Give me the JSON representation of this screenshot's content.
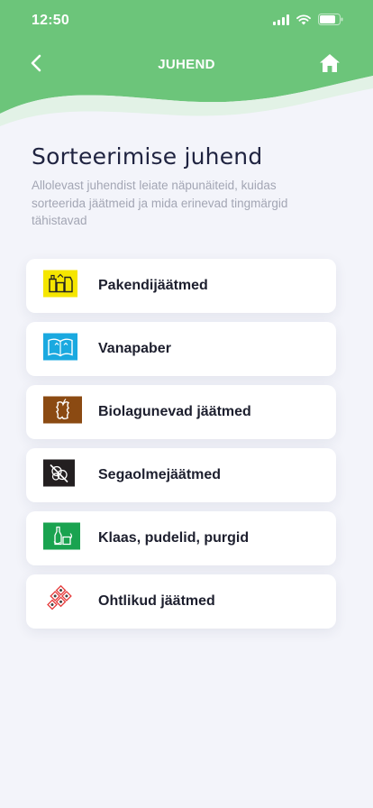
{
  "status_bar": {
    "time": "12:50"
  },
  "nav": {
    "title": "JUHEND",
    "back_icon": "chevron-left-icon",
    "home_icon": "home-icon"
  },
  "main": {
    "title": "Sorteerimise juhend",
    "subtitle": "Allolevast juhendist leiate näpunäiteid, kuidas sorteerida jäätmeid ja mida erinevad tingmärgid tähistavad",
    "categories": [
      {
        "label": "Pakendijäätmed",
        "icon": "packaging-icon",
        "color": "#f5e600"
      },
      {
        "label": "Vanapaber",
        "icon": "paper-icon",
        "color": "#1aa9e0"
      },
      {
        "label": "Biolagunevad jäätmed",
        "icon": "bio-waste-icon",
        "color": "#8b4a12"
      },
      {
        "label": "Segaolmejäätmed",
        "icon": "mixed-waste-icon",
        "color": "#231f20"
      },
      {
        "label": "Klaas, pudelid, purgid",
        "icon": "glass-icon",
        "color": "#1aa350"
      },
      {
        "label": "Ohtlikud jäätmed",
        "icon": "hazardous-waste-icon",
        "color": "#e53a3a"
      }
    ]
  },
  "colors": {
    "header_green": "#6cc57a",
    "background": "#f3f4fa"
  }
}
